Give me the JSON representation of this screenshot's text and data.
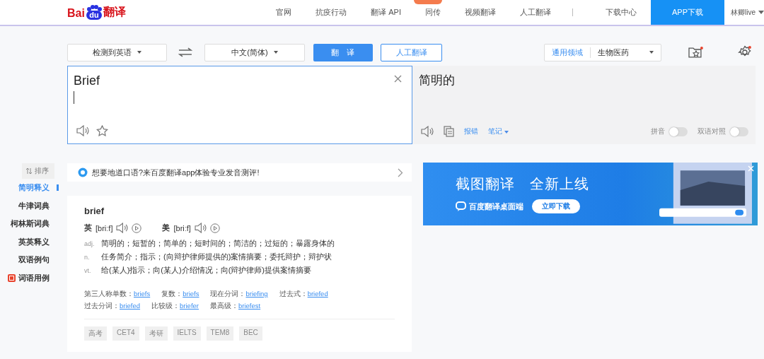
{
  "logo": {
    "text_left": "Bai",
    "paw_text": "du",
    "text_right": "翻译"
  },
  "nav": {
    "items": [
      {
        "label": "官网",
        "badge": false
      },
      {
        "label": "抗疫行动",
        "badge": false
      },
      {
        "label": "翻译 API",
        "badge": false
      },
      {
        "label": "同传",
        "badge": true
      },
      {
        "label": "视频翻译",
        "badge": false
      },
      {
        "label": "人工翻译",
        "badge": false
      }
    ],
    "download_center": "下载中心",
    "app_button": "APP下载",
    "user": "林卿live"
  },
  "toolbar": {
    "source_lang": "检测到英语",
    "target_lang": "中文(简体)",
    "translate_button": "翻　译",
    "human_button": "人工翻译",
    "domain_label": "通用领域",
    "domain_value": "生物医药"
  },
  "input": {
    "value": "Brief"
  },
  "output": {
    "text": "简明的",
    "report": "报错",
    "notes": "笔记",
    "pinyin_label": "拼音",
    "pinyin_on": false,
    "bilingual_label": "双语对照",
    "bilingual_on": false
  },
  "sidebar": {
    "sort_label": "排序",
    "items": [
      {
        "label": "简明释义",
        "selected": true,
        "badge": false
      },
      {
        "label": "牛津词典",
        "selected": false,
        "badge": false
      },
      {
        "label": "柯林斯词典",
        "selected": false,
        "badge": false
      },
      {
        "label": "英英释义",
        "selected": false,
        "badge": false
      },
      {
        "label": "双语例句",
        "selected": false,
        "badge": false
      },
      {
        "label": "词语用例",
        "selected": false,
        "badge": true
      }
    ]
  },
  "promo": {
    "text": "想要地道口语?来百度翻译app体验专业发音测评!"
  },
  "dictionary": {
    "word": "brief",
    "phonetics": [
      {
        "region": "英",
        "ipa": "[briːf]"
      },
      {
        "region": "美",
        "ipa": "[briːf]"
      }
    ],
    "senses": [
      {
        "pos": "adj.",
        "meaning": "简明的；短暂的；简单的；短时间的；简洁的；过短的；暴露身体的"
      },
      {
        "pos": "n.",
        "meaning": "任务简介；指示；(向辩护律师提供的)案情摘要；委托辩护；辩护状"
      },
      {
        "pos": "vt.",
        "meaning": "给(某人)指示；向(某人)介绍情况；向(辩护律师)提供案情摘要"
      }
    ],
    "form_lines": [
      [
        {
          "label": "第三人称单数：",
          "value": "briefs"
        },
        {
          "label": "复数：",
          "value": "briefs"
        },
        {
          "label": "现在分词：",
          "value": "briefing"
        },
        {
          "label": "过去式：",
          "value": "briefed"
        }
      ],
      [
        {
          "label": "过去分词：",
          "value": "briefed"
        },
        {
          "label": "比较级：",
          "value": "briefer"
        },
        {
          "label": "最高级：",
          "value": "briefest"
        }
      ]
    ],
    "tags": [
      "高考",
      "CET4",
      "考研",
      "IELTS",
      "TEM8",
      "BEC"
    ]
  },
  "banner": {
    "title": "截图翻译　全新上线",
    "product": "百度翻译桌面端",
    "button": "立即下载"
  }
}
